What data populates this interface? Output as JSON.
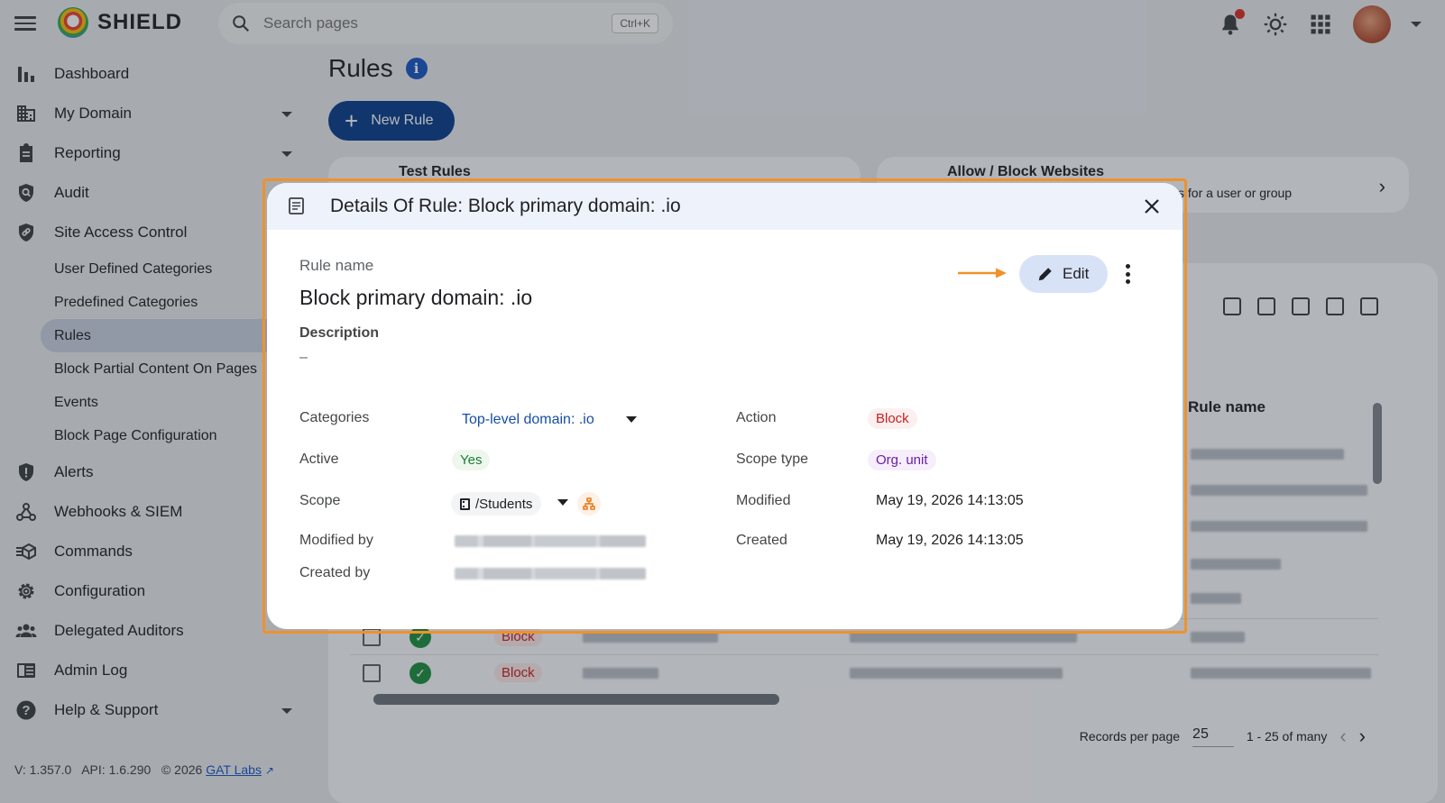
{
  "app": {
    "name": "SHIELD"
  },
  "search": {
    "placeholder": "Search pages",
    "shortcut": "Ctrl+K"
  },
  "sidebar": {
    "items": [
      {
        "label": "Dashboard",
        "icon": "bar-chart-icon"
      },
      {
        "label": "My Domain",
        "icon": "building-icon",
        "expandable": true
      },
      {
        "label": "Reporting",
        "icon": "clipboard-icon",
        "expandable": true
      },
      {
        "label": "Audit",
        "icon": "shield-search-icon"
      },
      {
        "label": "Site Access Control",
        "icon": "shield-link-icon"
      }
    ],
    "sub_items": [
      {
        "label": "User Defined Categories"
      },
      {
        "label": "Predefined Categories"
      },
      {
        "label": "Rules",
        "active": true
      },
      {
        "label": "Block Partial Content On Pages"
      },
      {
        "label": "Events"
      },
      {
        "label": "Block Page Configuration"
      }
    ],
    "items_bottom": [
      {
        "label": "Alerts",
        "icon": "alert-shield-icon"
      },
      {
        "label": "Webhooks & SIEM",
        "icon": "webhook-icon"
      },
      {
        "label": "Commands",
        "icon": "commands-icon"
      },
      {
        "label": "Configuration",
        "icon": "gear-icon"
      },
      {
        "label": "Delegated Auditors",
        "icon": "people-icon"
      },
      {
        "label": "Admin Log",
        "icon": "log-icon"
      },
      {
        "label": "Help & Support",
        "icon": "help-icon",
        "expandable": true
      }
    ],
    "footer": {
      "version": "V: 1.357.0",
      "api": "API: 1.6.290",
      "copyright": "© 2026",
      "company": "GAT Labs"
    }
  },
  "main": {
    "title": "Rules",
    "new_rule_label": "New Rule",
    "cards": [
      {
        "title": "Test Rules",
        "desc": ""
      },
      {
        "title": "Allow / Block Websites",
        "desc": "URLs for a user or group"
      }
    ],
    "table": {
      "visible_header": "Rule name",
      "rows": [
        {
          "action": "Block"
        },
        {
          "action": "Block"
        }
      ]
    },
    "pager": {
      "label": "Records per page",
      "per_page": "25",
      "range": "1 - 25 of many"
    }
  },
  "dialog": {
    "title": "Details Of Rule: Block primary domain: .io",
    "rule_name_label": "Rule name",
    "rule_name": "Block primary domain: .io",
    "edit_label": "Edit",
    "description_label": "Description",
    "description_value": "–",
    "fields": {
      "categories_label": "Categories",
      "categories_value": "Top-level domain: .io",
      "active_label": "Active",
      "active_value": "Yes",
      "scope_label": "Scope",
      "scope_value": "/Students",
      "modified_by_label": "Modified by",
      "created_by_label": "Created by",
      "action_label": "Action",
      "action_value": "Block",
      "scope_type_label": "Scope type",
      "scope_type_value": "Org. unit",
      "modified_label": "Modified",
      "modified_value": "May 19, 2026 14:13:05",
      "created_label": "Created",
      "created_value": "May 19, 2026 14:13:05"
    }
  },
  "colors": {
    "accent": "#0b3f8c",
    "highlight": "#f0912a",
    "danger": "#c5221f",
    "success": "#1e8e3e"
  }
}
